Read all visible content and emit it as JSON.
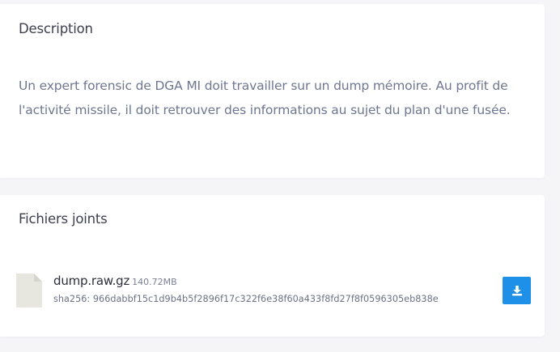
{
  "description": {
    "title": "Description",
    "text": "Un expert forensic de DGA MI doit travailler sur un dump mémoire. Au profit de l'activité missile, il doit retrouver des informations au sujet du plan d'une fusée."
  },
  "attachments": {
    "title": "Fichiers joints",
    "files": [
      {
        "name": "dump.raw.gz",
        "size": "140.72MB",
        "hash": "sha256: 966dabbf15c1d9b4b5f2896f17c322f6e38f60a433f8fd27f8f0596305eb838e",
        "icon": "file-icon",
        "action_icon": "download-icon"
      }
    ]
  },
  "colors": {
    "accent": "#1e90e8",
    "page_background": "#f5f5f8",
    "card_background": "#ffffff",
    "file_icon": "#e8e7df"
  }
}
